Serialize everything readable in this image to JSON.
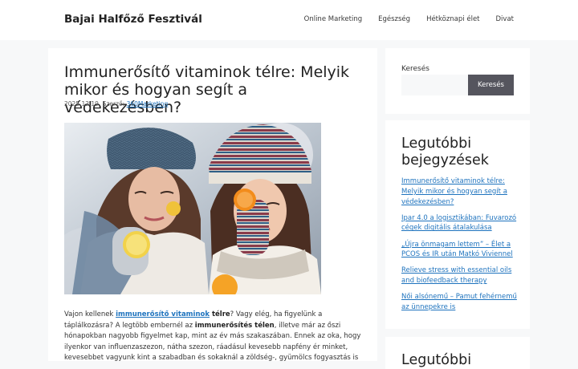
{
  "site": {
    "title": "Bajai Halfőző Fesztivál"
  },
  "nav": {
    "items": [
      "Online Marketing",
      "Egészség",
      "Hétköznapi élet",
      "Divat"
    ]
  },
  "article": {
    "title": "Immunerősítő vitaminok télre: Melyik mikor és hogyan segít a védekezésben?",
    "date": "2025.12.19.",
    "author_prefix": "Szerző:",
    "author": "360Marketing",
    "p_intro": "Vajon kellenek ",
    "p_link": "immunerősítő vitaminok",
    "p_bold1": " télre",
    "p_text1": "? Vagy elég, ha figyelünk a táplálkozásra? A legtöbb embernél az ",
    "p_bold2": "immunerősítés télen",
    "p_text2": ", illetve már az őszi hónapokban nagyobb figyelmet kap, mint az év más szakaszában. Ennek az oka, hogy ilyenkor van influenzaszezon, nátha szezon, ráadásul kevesebb napfény ér minket, kevesebbet vagyunk kint a szabadban és sokaknál a zöldség-, gyümölcs fogyasztás is"
  },
  "search": {
    "label": "Keresés",
    "placeholder": "",
    "button": "Keresés"
  },
  "recent": {
    "title": "Legutóbbi bejegyzések",
    "items": [
      "Immunerősítő vitaminok télre: Melyik mikor és hogyan segít a védekezésben?",
      "Ipar 4.0 a logisztikában: Fuvarozó cégek digitális átalakulása",
      "„Újra önmagam lettem” – Élet a PCOS és IR után Matkó Viviennel",
      "Relieve stress with essential oils and biofeedback therapy",
      "Női alsónemű – Pamut fehérnemű az ünnepekre is"
    ]
  },
  "recent2": {
    "title": "Legutóbbi"
  },
  "colors": {
    "link": "#1e73be",
    "button": "#55555e",
    "background": "#f7f8f9"
  }
}
